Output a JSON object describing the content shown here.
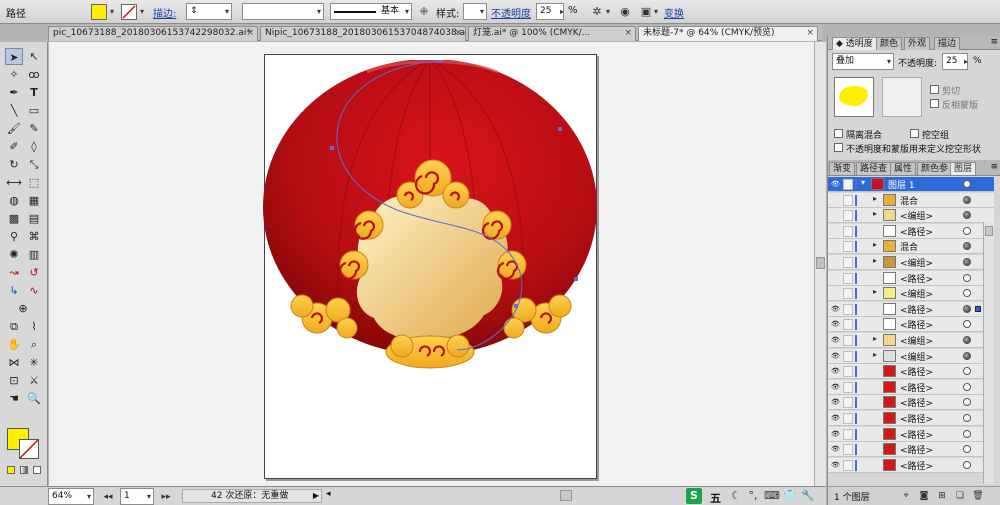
{
  "control_bar": {
    "tool_label": "路径",
    "stroke_link": "描边:",
    "stroke_style": "基本",
    "style_label": "样式:",
    "opacity_link": "不透明度",
    "opacity_value": "25",
    "percent": "%",
    "transform_link": "变换",
    "fill_color": "#ffee00"
  },
  "tabs": [
    {
      "label": "pic_10673188_20180306153742298032.ai*"
    },
    {
      "label": "Nipic_10673188_20180306153704874038.ai"
    },
    {
      "label": "灯笼.ai* @ 100% (CMYK/..."
    },
    {
      "label": "未标题-7* @ 64% (CMYK/预览)"
    }
  ],
  "status_bar": {
    "zoom": "64%",
    "page": "1",
    "undo_text": "42 次还原：无重做",
    "ime_label": "五"
  },
  "transparency_panel": {
    "tabs": [
      "透明度",
      "颜色",
      "外观",
      "描边"
    ],
    "blend_mode": "叠加",
    "opacity_label": "不透明度:",
    "opacity_value": "25",
    "percent": "%",
    "clip_label": "剪切",
    "invert_mask_label": "反相蒙版",
    "isolate_blend_label": "隔离混合",
    "knockout_group_label": "挖空组",
    "opacity_mask_label": "不透明度和蒙版用来定义挖空形状"
  },
  "layers_panel": {
    "tabs": [
      "渐变",
      "路径查",
      "属性",
      "颜色参",
      "图层"
    ],
    "layers": [
      {
        "name": "图层 1",
        "top": true,
        "visible": true,
        "thumb": "#c8102e",
        "expand": "▾",
        "indent": 0
      },
      {
        "name": "混合",
        "visible": false,
        "thumb": "#e8b03a",
        "expand": "▸",
        "indent": 1,
        "fill": true
      },
      {
        "name": "<编组>",
        "visible": false,
        "thumb": "#f2d98a",
        "expand": "▸",
        "indent": 1,
        "fill": true
      },
      {
        "name": "<路径>",
        "visible": false,
        "thumb": "#ffffff",
        "expand": "",
        "indent": 1
      },
      {
        "name": "混合",
        "visible": false,
        "thumb": "#e8b03a",
        "expand": "▸",
        "indent": 1,
        "fill": true
      },
      {
        "name": "<编组>",
        "visible": false,
        "thumb": "#c89a40",
        "expand": "▸",
        "indent": 1,
        "fill": true
      },
      {
        "name": "<路径>",
        "visible": false,
        "thumb": "#ffffff",
        "expand": "",
        "indent": 1
      },
      {
        "name": "<编组>",
        "visible": false,
        "thumb": "#f5ef8a",
        "expand": "▸",
        "indent": 1
      },
      {
        "name": "<路径>",
        "visible": true,
        "thumb": "#ffffff",
        "expand": "",
        "indent": 1,
        "fill": true
      },
      {
        "name": "<路径>",
        "visible": true,
        "thumb": "#ffffff",
        "expand": "",
        "indent": 1
      },
      {
        "name": "<编组>",
        "visible": true,
        "thumb": "#f2d98a",
        "expand": "▸",
        "indent": 1,
        "fill": true
      },
      {
        "name": "<编组>",
        "visible": true,
        "thumb": "#e0e0e0",
        "expand": "▸",
        "indent": 1,
        "fill": true
      },
      {
        "name": "<路径>",
        "visible": true,
        "thumb": "#d01a1a",
        "expand": "",
        "indent": 1
      },
      {
        "name": "<路径>",
        "visible": true,
        "thumb": "#d01a1a",
        "expand": "",
        "indent": 1
      },
      {
        "name": "<路径>",
        "visible": true,
        "thumb": "#d01a1a",
        "expand": "",
        "indent": 1
      },
      {
        "name": "<路径>",
        "visible": true,
        "thumb": "#d01a1a",
        "expand": "",
        "indent": 1
      },
      {
        "name": "<路径>",
        "visible": true,
        "thumb": "#d01a1a",
        "expand": "",
        "indent": 1
      },
      {
        "name": "<路径>",
        "visible": true,
        "thumb": "#d01a1a",
        "expand": "",
        "indent": 1
      },
      {
        "name": "<路径>",
        "visible": true,
        "thumb": "#d01a1a",
        "expand": "",
        "indent": 1
      }
    ],
    "footer_label": "1 个图层"
  }
}
